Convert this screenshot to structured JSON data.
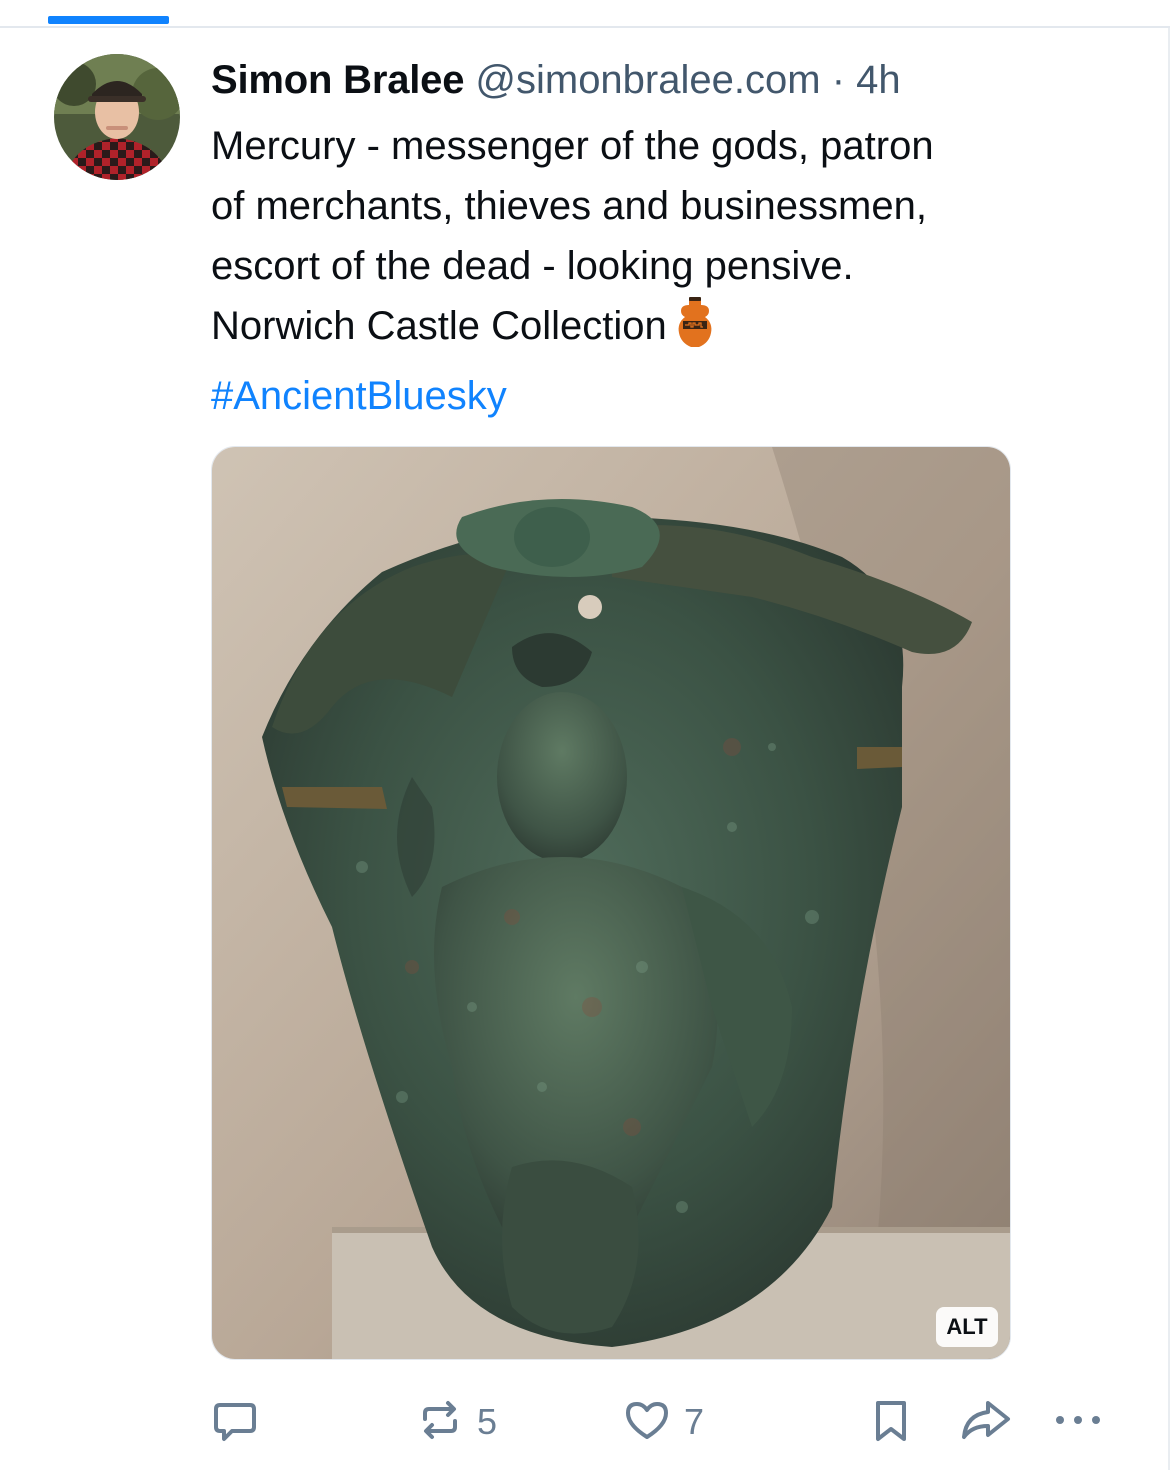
{
  "post": {
    "author": {
      "name": "Simon Bralee",
      "handle": "@simonbralee.com",
      "separator": "·",
      "time": "4h"
    },
    "text_lines": [
      "Mercury - messenger of the gods, patron",
      "of merchants, thieves and businessmen,",
      "escort of the dead - looking pensive.",
      "Norwich Castle Collection"
    ],
    "text_emoji": "amphora-emoji",
    "hashtag": "#AncientBluesky",
    "image": {
      "alt_label": "ALT"
    },
    "actions": {
      "reply": {
        "icon": "reply-icon",
        "count": ""
      },
      "repost": {
        "icon": "repost-icon",
        "count": "5"
      },
      "like": {
        "icon": "heart-icon",
        "count": "7"
      },
      "bookmark": {
        "icon": "bookmark-icon"
      },
      "share": {
        "icon": "share-icon"
      },
      "more": {
        "icon": "more-icon"
      }
    }
  },
  "colors": {
    "accent": "#1083fe",
    "text": "#0b0f14",
    "muted": "#42576c",
    "icon": "#6a7e93"
  }
}
